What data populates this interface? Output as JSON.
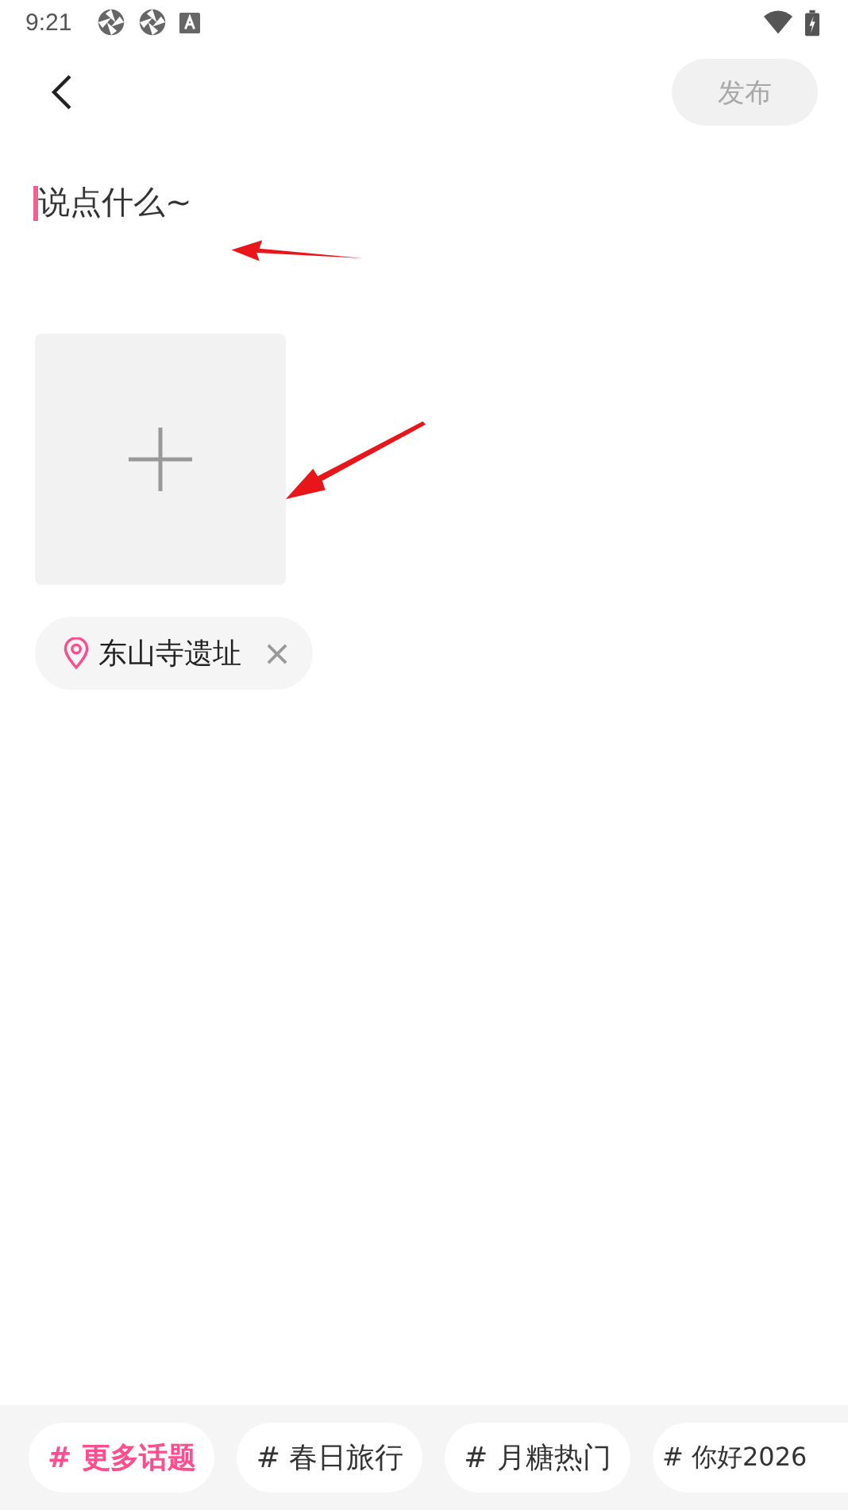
{
  "status_bar": {
    "time": "9:21"
  },
  "header": {
    "publish_button": {
      "label": "发布",
      "disabled": true
    }
  },
  "editor": {
    "placeholder": "说点什么~",
    "focused": true
  },
  "location": {
    "name": "东山寺遗址"
  },
  "topics": [
    {
      "label": "# 更多话题",
      "kind": "more"
    },
    {
      "label": "# 春日旅行",
      "kind": "topic"
    },
    {
      "label": "# 月糖热门",
      "kind": "topic"
    },
    {
      "label": "# 你好2026",
      "kind": "topic"
    }
  ]
}
